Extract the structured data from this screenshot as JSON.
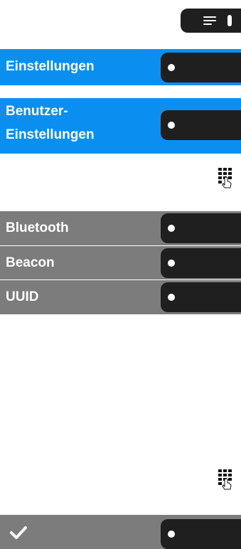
{
  "menu": {
    "icon": "menu-icon"
  },
  "rows_top": [
    {
      "label": "Einstellungen"
    },
    {
      "label_line1": "Benutzer-",
      "label_line2": "Einstellungen"
    }
  ],
  "rows_gray": [
    {
      "label": "Bluetooth"
    },
    {
      "label": "Beacon"
    },
    {
      "label": "UUID"
    }
  ],
  "footer": {
    "confirm_icon": "checkmark-icon"
  },
  "colors": {
    "blue": "#0a8ff0",
    "gray": "#7c7c7c",
    "key": "#1f1f1f"
  }
}
